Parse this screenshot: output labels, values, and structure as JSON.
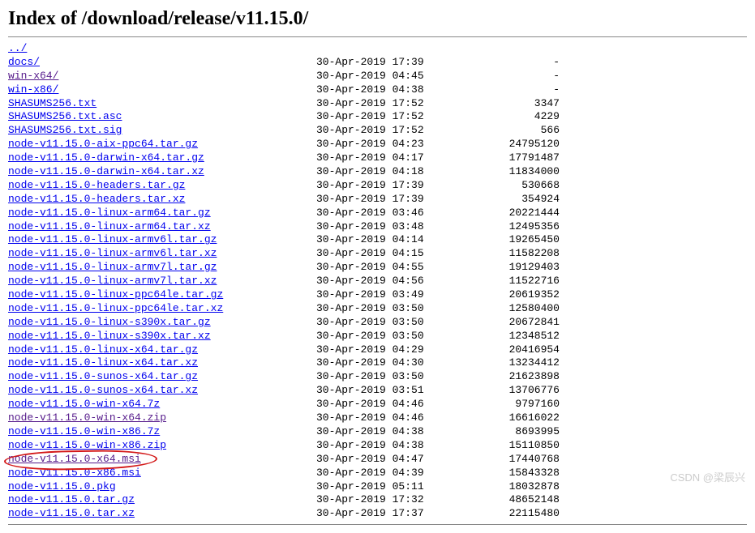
{
  "title": "Index of /download/release/v11.15.0/",
  "parent": {
    "name": "../",
    "date": "",
    "size": ""
  },
  "files": [
    {
      "name": "docs/",
      "date": "30-Apr-2019 17:39",
      "size": "-",
      "visited": false
    },
    {
      "name": "win-x64/",
      "date": "30-Apr-2019 04:45",
      "size": "-",
      "visited": true
    },
    {
      "name": "win-x86/",
      "date": "30-Apr-2019 04:38",
      "size": "-",
      "visited": false
    },
    {
      "name": "SHASUMS256.txt",
      "date": "30-Apr-2019 17:52",
      "size": "3347",
      "visited": false
    },
    {
      "name": "SHASUMS256.txt.asc",
      "date": "30-Apr-2019 17:52",
      "size": "4229",
      "visited": false
    },
    {
      "name": "SHASUMS256.txt.sig",
      "date": "30-Apr-2019 17:52",
      "size": "566",
      "visited": false
    },
    {
      "name": "node-v11.15.0-aix-ppc64.tar.gz",
      "date": "30-Apr-2019 04:23",
      "size": "24795120",
      "visited": false
    },
    {
      "name": "node-v11.15.0-darwin-x64.tar.gz",
      "date": "30-Apr-2019 04:17",
      "size": "17791487",
      "visited": false
    },
    {
      "name": "node-v11.15.0-darwin-x64.tar.xz",
      "date": "30-Apr-2019 04:18",
      "size": "11834000",
      "visited": false
    },
    {
      "name": "node-v11.15.0-headers.tar.gz",
      "date": "30-Apr-2019 17:39",
      "size": "530668",
      "visited": false
    },
    {
      "name": "node-v11.15.0-headers.tar.xz",
      "date": "30-Apr-2019 17:39",
      "size": "354924",
      "visited": false
    },
    {
      "name": "node-v11.15.0-linux-arm64.tar.gz",
      "date": "30-Apr-2019 03:46",
      "size": "20221444",
      "visited": false
    },
    {
      "name": "node-v11.15.0-linux-arm64.tar.xz",
      "date": "30-Apr-2019 03:48",
      "size": "12495356",
      "visited": false
    },
    {
      "name": "node-v11.15.0-linux-armv6l.tar.gz",
      "date": "30-Apr-2019 04:14",
      "size": "19265450",
      "visited": false
    },
    {
      "name": "node-v11.15.0-linux-armv6l.tar.xz",
      "date": "30-Apr-2019 04:15",
      "size": "11582208",
      "visited": false
    },
    {
      "name": "node-v11.15.0-linux-armv7l.tar.gz",
      "date": "30-Apr-2019 04:55",
      "size": "19129403",
      "visited": false
    },
    {
      "name": "node-v11.15.0-linux-armv7l.tar.xz",
      "date": "30-Apr-2019 04:56",
      "size": "11522716",
      "visited": false
    },
    {
      "name": "node-v11.15.0-linux-ppc64le.tar.gz",
      "date": "30-Apr-2019 03:49",
      "size": "20619352",
      "visited": false
    },
    {
      "name": "node-v11.15.0-linux-ppc64le.tar.xz",
      "date": "30-Apr-2019 03:50",
      "size": "12580400",
      "visited": false
    },
    {
      "name": "node-v11.15.0-linux-s390x.tar.gz",
      "date": "30-Apr-2019 03:50",
      "size": "20672841",
      "visited": false
    },
    {
      "name": "node-v11.15.0-linux-s390x.tar.xz",
      "date": "30-Apr-2019 03:50",
      "size": "12348512",
      "visited": false
    },
    {
      "name": "node-v11.15.0-linux-x64.tar.gz",
      "date": "30-Apr-2019 04:29",
      "size": "20416954",
      "visited": false
    },
    {
      "name": "node-v11.15.0-linux-x64.tar.xz",
      "date": "30-Apr-2019 04:30",
      "size": "13234412",
      "visited": false
    },
    {
      "name": "node-v11.15.0-sunos-x64.tar.gz",
      "date": "30-Apr-2019 03:50",
      "size": "21623898",
      "visited": false
    },
    {
      "name": "node-v11.15.0-sunos-x64.tar.xz",
      "date": "30-Apr-2019 03:51",
      "size": "13706776",
      "visited": false
    },
    {
      "name": "node-v11.15.0-win-x64.7z",
      "date": "30-Apr-2019 04:46",
      "size": "9797160",
      "visited": false
    },
    {
      "name": "node-v11.15.0-win-x64.zip",
      "date": "30-Apr-2019 04:46",
      "size": "16616022",
      "visited": true
    },
    {
      "name": "node-v11.15.0-win-x86.7z",
      "date": "30-Apr-2019 04:38",
      "size": "8693995",
      "visited": false
    },
    {
      "name": "node-v11.15.0-win-x86.zip",
      "date": "30-Apr-2019 04:38",
      "size": "15110850",
      "visited": false
    },
    {
      "name": "node-v11.15.0-x64.msi",
      "date": "30-Apr-2019 04:47",
      "size": "17440768",
      "visited": true,
      "highlighted": true
    },
    {
      "name": "node-v11.15.0-x86.msi",
      "date": "30-Apr-2019 04:39",
      "size": "15843328",
      "visited": false
    },
    {
      "name": "node-v11.15.0.pkg",
      "date": "30-Apr-2019 05:11",
      "size": "18032878",
      "visited": false
    },
    {
      "name": "node-v11.15.0.tar.gz",
      "date": "30-Apr-2019 17:32",
      "size": "48652148",
      "visited": false
    },
    {
      "name": "node-v11.15.0.tar.xz",
      "date": "30-Apr-2019 17:37",
      "size": "22115480",
      "visited": false
    }
  ],
  "watermark": "CSDN @梁辰兴"
}
